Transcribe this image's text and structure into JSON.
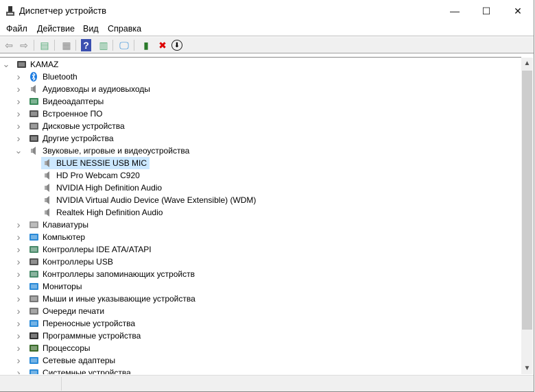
{
  "window": {
    "title": "Диспетчер устройств",
    "minimize": "—",
    "maximize": "☐",
    "close": "✕"
  },
  "menu": [
    "Файл",
    "Действие",
    "Вид",
    "Справка"
  ],
  "toolbar": [
    {
      "icon": "back-arrow-icon",
      "glyph": "⇦"
    },
    {
      "icon": "forward-arrow-icon",
      "glyph": "⇨"
    },
    {
      "icon": "show-hide-console-tree-icon",
      "glyph": "▤"
    },
    {
      "icon": "properties-icon",
      "glyph": "▦"
    },
    {
      "icon": "help-icon",
      "glyph": "?"
    },
    {
      "icon": "action-pane-icon",
      "glyph": "▥"
    },
    {
      "icon": "scan-hardware-monitor-icon",
      "glyph": "🖵"
    },
    {
      "icon": "update-driver-icon",
      "glyph": "▮"
    },
    {
      "icon": "uninstall-device-icon",
      "glyph": "✖"
    },
    {
      "icon": "disable-device-download-icon",
      "glyph": "⬇"
    }
  ],
  "tree": {
    "root": "KAMAZ",
    "items": [
      {
        "label": "Bluetooth",
        "icon": "bluetooth-icon",
        "color": "#1e7ce0",
        "expanded": false
      },
      {
        "label": "Аудиовходы и аудиовыходы",
        "icon": "speaker-icon",
        "color": "#888888",
        "expanded": false
      },
      {
        "label": "Видеоадаптеры",
        "icon": "display-adapter-icon",
        "color": "#3a8a5a",
        "expanded": false
      },
      {
        "label": "Встроенное ПО",
        "icon": "firmware-chip-icon",
        "color": "#555555",
        "expanded": false
      },
      {
        "label": "Дисковые устройства",
        "icon": "disk-drive-icon",
        "color": "#666666",
        "expanded": false
      },
      {
        "label": "Другие устройства",
        "icon": "other-devices-icon",
        "color": "#444444",
        "expanded": false
      },
      {
        "label": "Звуковые, игровые и видеоустройства",
        "icon": "speaker-icon",
        "color": "#888888",
        "expanded": true,
        "children": [
          {
            "label": "BLUE NESSIE USB MIC",
            "selected": true
          },
          {
            "label": "HD Pro Webcam C920"
          },
          {
            "label": "NVIDIA High Definition Audio"
          },
          {
            "label": "NVIDIA Virtual Audio Device (Wave Extensible) (WDM)"
          },
          {
            "label": "Realtek High Definition Audio"
          }
        ]
      },
      {
        "label": "Клавиатуры",
        "icon": "keyboard-icon",
        "color": "#999999",
        "expanded": false
      },
      {
        "label": "Компьютер",
        "icon": "computer-icon",
        "color": "#2a8ad8",
        "expanded": false
      },
      {
        "label": "Контроллеры IDE ATA/ATAPI",
        "icon": "ide-controller-icon",
        "color": "#4a8a6a",
        "expanded": false
      },
      {
        "label": "Контроллеры USB",
        "icon": "usb-icon",
        "color": "#555555",
        "expanded": false
      },
      {
        "label": "Контроллеры запоминающих устройств",
        "icon": "storage-controller-icon",
        "color": "#4a8a6a",
        "expanded": false
      },
      {
        "label": "Мониторы",
        "icon": "monitor-icon",
        "color": "#2a8ad8",
        "expanded": false
      },
      {
        "label": "Мыши и иные указывающие устройства",
        "icon": "mouse-icon",
        "color": "#777777",
        "expanded": false
      },
      {
        "label": "Очереди печати",
        "icon": "printer-icon",
        "color": "#777777",
        "expanded": false
      },
      {
        "label": "Переносные устройства",
        "icon": "portable-device-icon",
        "color": "#2a8ad8",
        "expanded": false
      },
      {
        "label": "Программные устройства",
        "icon": "software-device-icon",
        "color": "#333333",
        "expanded": false
      },
      {
        "label": "Процессоры",
        "icon": "processor-icon",
        "color": "#3a6a2a",
        "expanded": false
      },
      {
        "label": "Сетевые адаптеры",
        "icon": "network-adapter-icon",
        "color": "#2a8ad8",
        "expanded": false
      },
      {
        "label": "Системные устройства",
        "icon": "system-devices-icon",
        "color": "#2a8ad8",
        "expanded": false
      }
    ]
  }
}
